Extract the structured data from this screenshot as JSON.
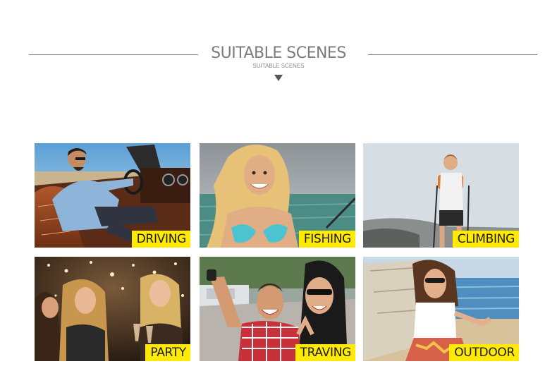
{
  "header": {
    "title": "SUITABLE SCENES",
    "subtitle": "SUITABLE SCENES"
  },
  "scenes": [
    {
      "label": "DRIVING",
      "photo": "man driving convertible car wearing sunglasses"
    },
    {
      "label": "FISHING",
      "photo": "blonde woman on a boat with fishing rod"
    },
    {
      "label": "CLIMBING",
      "photo": "woman hiking with trekking poles"
    },
    {
      "label": "PARTY",
      "photo": "women toasting with drinks at a party"
    },
    {
      "label": "TRAVING",
      "photo": "couple taking a selfie outdoors"
    },
    {
      "label": "OUTDOOR",
      "photo": "woman in sunglasses sitting by the sea"
    }
  ],
  "colors": {
    "badge": "#ffea00",
    "title": "#7c7c7c",
    "rule": "#8c8c8c"
  }
}
